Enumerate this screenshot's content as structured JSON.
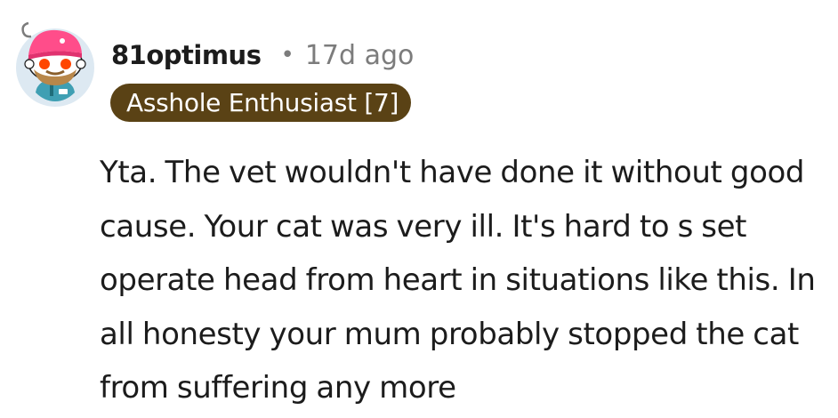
{
  "comment": {
    "username": "81optimus",
    "separator": "•",
    "timestamp": "17d ago",
    "flair": "Asshole Enthusiast [7]",
    "body": "Yta. The vet wouldn't have done it without good cause. Your cat was very ill. It's hard to s set operate head from heart in situations like this. In all honesty your mum probably stopped the cat from suffering any more",
    "avatar_icon": "snoo-avatar-icon"
  },
  "colors": {
    "flair_background": "#5a4215",
    "flair_text": "#ffffff",
    "meta_text": "#7c7c7c",
    "body_text": "#1c1c1c",
    "avatar_background": "#dde9f2"
  }
}
